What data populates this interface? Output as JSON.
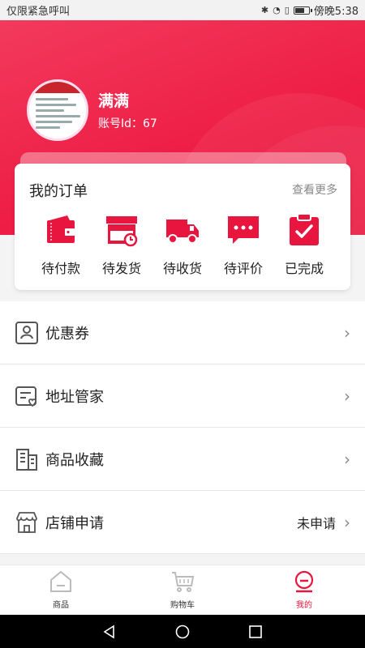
{
  "status_bar": {
    "left_text": "仅限紧急呼叫",
    "time": "傍晚5:38",
    "battery_level": 0.7
  },
  "profile": {
    "name": "满满",
    "account_id": "账号Id：67"
  },
  "orders": {
    "title": "我的订单",
    "more_label": "查看更多",
    "items": [
      {
        "label": "待付款",
        "icon": "wallet-icon"
      },
      {
        "label": "待发货",
        "icon": "box-clock-icon"
      },
      {
        "label": "待收货",
        "icon": "truck-icon"
      },
      {
        "label": "待评价",
        "icon": "chat-bubble-icon"
      },
      {
        "label": "已完成",
        "icon": "clipboard-check-icon"
      }
    ]
  },
  "menu": [
    {
      "label": "优惠券",
      "icon": "coupon-icon",
      "status": ""
    },
    {
      "label": "地址管家",
      "icon": "address-icon",
      "status": ""
    },
    {
      "label": "商品收藏",
      "icon": "building-icon",
      "status": ""
    },
    {
      "label": "店铺申请",
      "icon": "store-icon",
      "status": "未申请"
    }
  ],
  "tabbar": [
    {
      "label": "商品",
      "icon": "home-icon",
      "active": false
    },
    {
      "label": "购物车",
      "icon": "cart-icon",
      "active": false
    },
    {
      "label": "我的",
      "icon": "profile-icon",
      "active": true
    }
  ],
  "colors": {
    "accent": "#e8163e",
    "header_start": "#f23a5c"
  }
}
